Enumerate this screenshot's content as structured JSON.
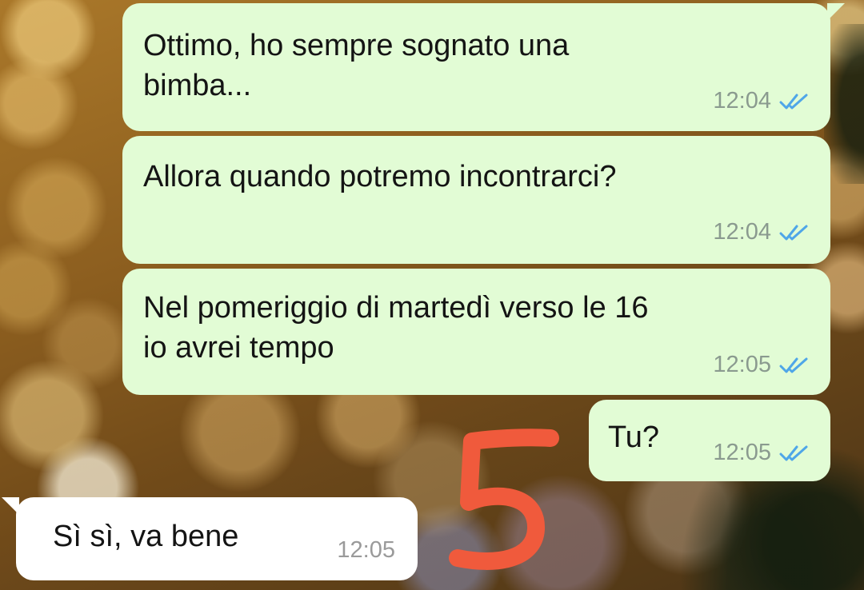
{
  "messages": [
    {
      "direction": "outgoing",
      "text": "Ottimo, ho sempre sognato una\nbimba...",
      "time": "12:04",
      "status": "read"
    },
    {
      "direction": "outgoing",
      "text": "Allora quando potremo incontrarci?",
      "time": "12:04",
      "status": "read"
    },
    {
      "direction": "outgoing",
      "text": "Nel pomeriggio di martedì verso le 16\nio avrei tempo",
      "time": "12:05",
      "status": "read"
    },
    {
      "direction": "outgoing",
      "text": "Tu?",
      "time": "12:05",
      "status": "read"
    },
    {
      "direction": "incoming",
      "text": "Sì sì, va bene",
      "time": "12:05"
    }
  ],
  "annotation": {
    "text": "5",
    "color": "#f05a3c"
  },
  "colors": {
    "outgoing_bubble": "#e2fcd5",
    "incoming_bubble": "#ffffff",
    "read_ticks": "#4fa6e8"
  },
  "icons": {
    "read_receipt": "double-check-icon"
  }
}
